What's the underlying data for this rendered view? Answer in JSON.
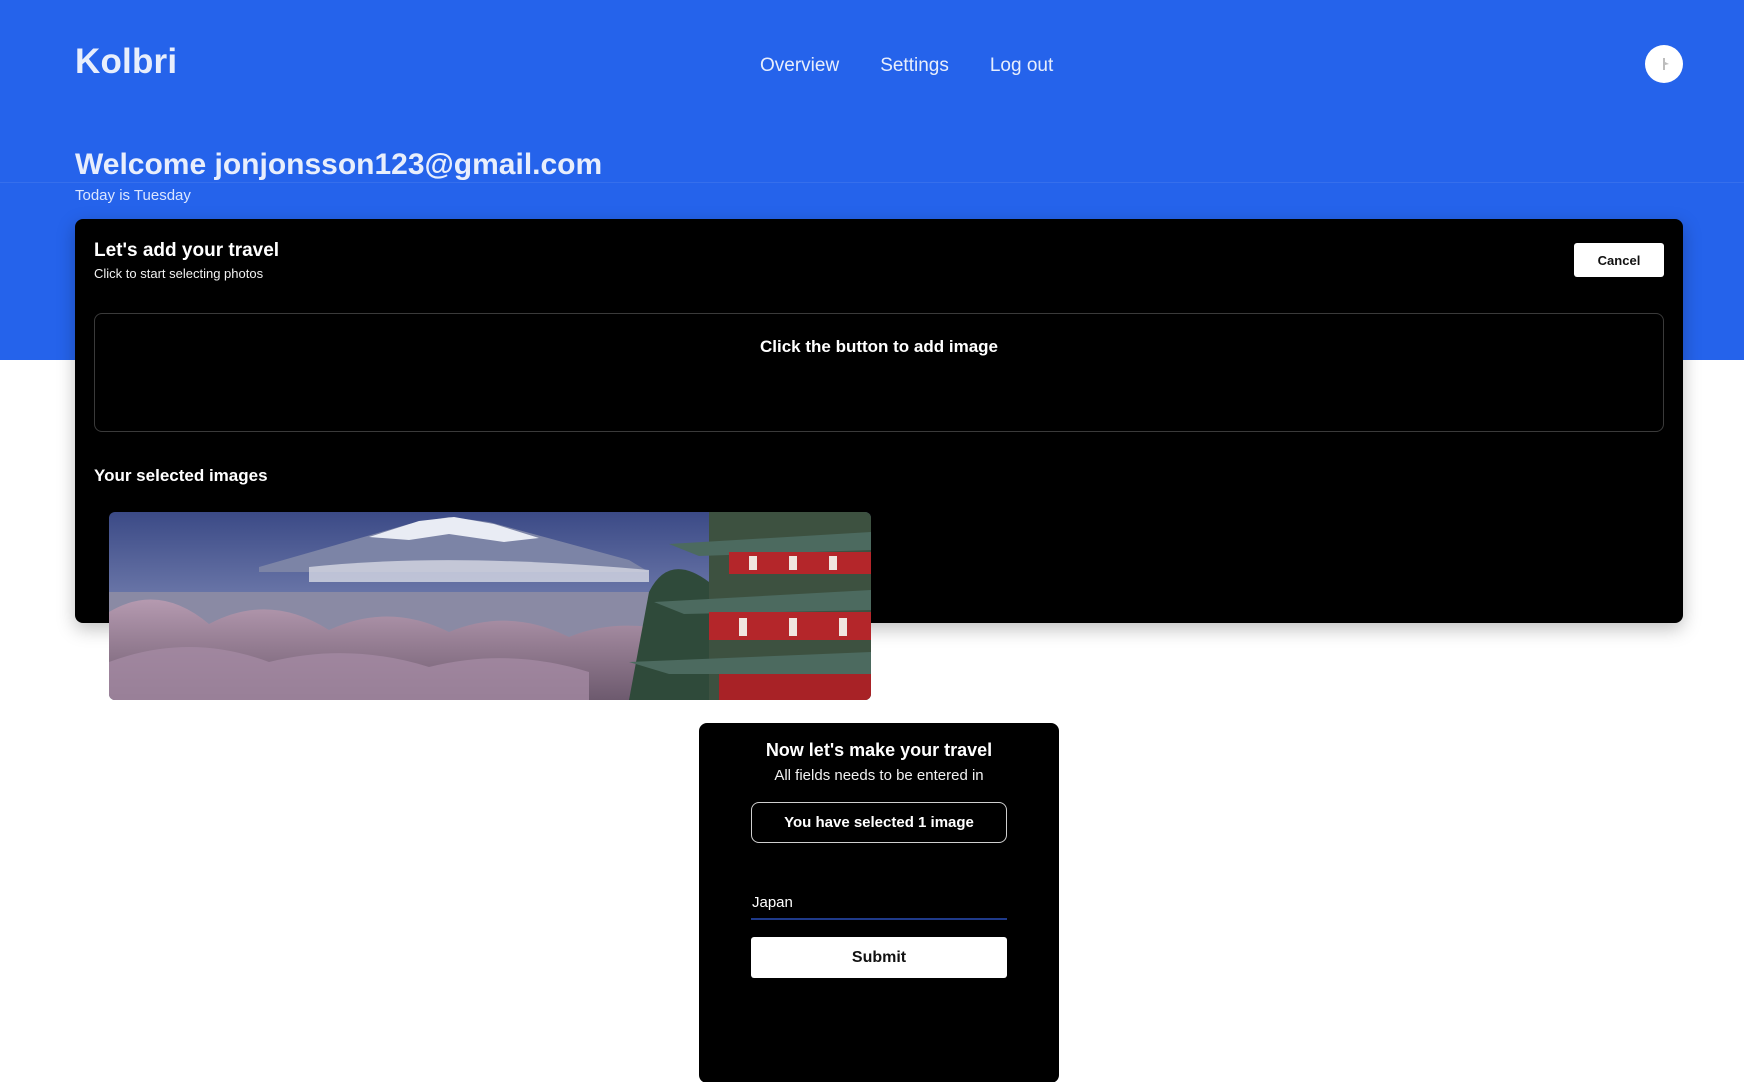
{
  "header": {
    "brand": "Kolbri",
    "nav": [
      {
        "label": "Overview"
      },
      {
        "label": "Settings"
      },
      {
        "label": "Log out"
      }
    ],
    "avatar_icon": "user-avatar-icon"
  },
  "hero": {
    "welcome": "Welcome jonjonsson123@gmail.com",
    "today": "Today is Tuesday",
    "background_color": "#2563eb"
  },
  "add_travel": {
    "title": "Let's add your travel",
    "subtitle": "Click to start selecting photos",
    "cancel_label": "Cancel",
    "dropzone_text": "Click the button to add image",
    "selected_label": "Your selected images"
  },
  "travel_form": {
    "title": "Now let's make your travel",
    "subtitle": "All fields needs to be entered in",
    "selected_count_text": "You have selected 1 image",
    "country_value": "Japan",
    "submit_label": "Submit"
  }
}
